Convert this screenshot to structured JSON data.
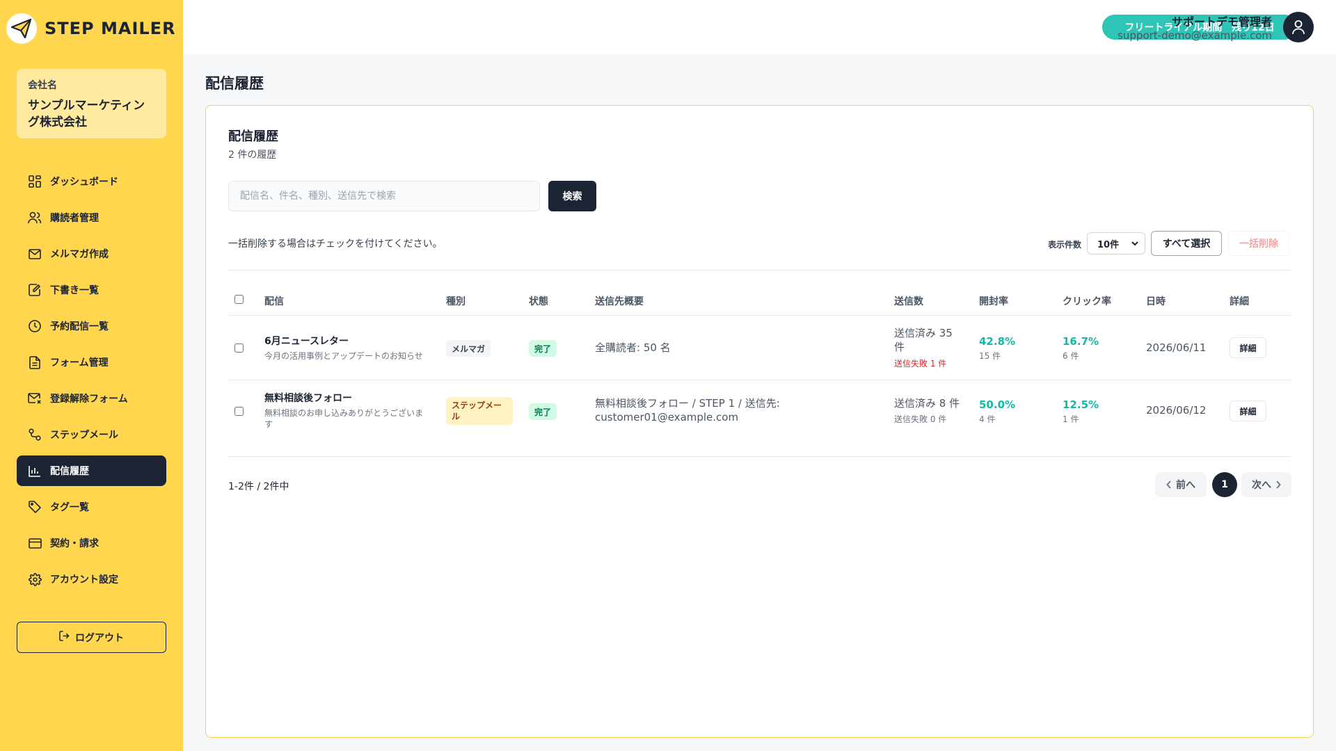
{
  "app": {
    "logo_text": "STEP MAILER"
  },
  "company": {
    "label": "会社名",
    "name": "サンプルマーケティング株式会社"
  },
  "sidebar": {
    "items": [
      {
        "label": "ダッシュボード",
        "icon": "dashboard-icon"
      },
      {
        "label": "購読者管理",
        "icon": "users-icon"
      },
      {
        "label": "メルマガ作成",
        "icon": "mail-icon"
      },
      {
        "label": "下書き一覧",
        "icon": "edit-icon"
      },
      {
        "label": "予約配信一覧",
        "icon": "clock-icon"
      },
      {
        "label": "フォーム管理",
        "icon": "document-icon"
      },
      {
        "label": "登録解除フォーム",
        "icon": "mail-x-icon"
      },
      {
        "label": "ステップメール",
        "icon": "route-icon"
      },
      {
        "label": "配信履歴",
        "icon": "bar-chart-icon",
        "active": true
      },
      {
        "label": "タグ一覧",
        "icon": "tag-icon"
      },
      {
        "label": "契約・請求",
        "icon": "credit-card-icon"
      },
      {
        "label": "アカウント設定",
        "icon": "gear-icon"
      }
    ],
    "logout_label": "ログアウト"
  },
  "header": {
    "trial": "フリートライアル期間　残り12日",
    "user_name": "サポートデモ管理者",
    "user_email": "support-demo@example.com"
  },
  "page": {
    "title": "配信履歴"
  },
  "card": {
    "title": "配信履歴",
    "subtitle": "2 件の履歴",
    "search_placeholder": "配信名、件名、種別、送信先で検索",
    "search_button": "検索",
    "note": "一括削除する場合はチェックを付けてください。",
    "per_page_label": "表示件数",
    "per_page_value": "10件",
    "select_all": "すべて選択",
    "bulk_delete": "一括削除"
  },
  "table": {
    "headers": {
      "delivery": "配信",
      "type": "種別",
      "status": "状態",
      "recipients": "送信先概要",
      "sent": "送信数",
      "open": "開封率",
      "click": "クリック率",
      "date": "日時",
      "detail": "詳細"
    },
    "rows": [
      {
        "title": "6月ニュースレター",
        "desc": "今月の活用事例とアップデートのお知らせ",
        "type": "メルマガ",
        "status": "完了",
        "recipients": "全購読者: 50 名",
        "sent": "送信済み 35 件",
        "failed": "送信失敗 1 件",
        "open_rate": "42.8%",
        "open_count": "15 件",
        "click_rate": "16.7%",
        "click_count": "6 件",
        "date": "2026/06/11",
        "detail": "詳細"
      },
      {
        "title": "無料相談後フォロー",
        "desc": "無料相談のお申し込みありがとうございます",
        "type": "ステップメール",
        "status": "完了",
        "recipients": "無料相談後フォロー / STEP 1 / 送信先: customer01@example.com",
        "sent": "送信済み 8 件",
        "failed": "送信失敗 0 件",
        "open_rate": "50.0%",
        "open_count": "4 件",
        "click_rate": "12.5%",
        "click_count": "1 件",
        "date": "2026/06/12",
        "detail": "詳細"
      }
    ]
  },
  "pagination": {
    "range": "1-2件 / 2件中",
    "prev": "前へ",
    "current": "1",
    "next": "次へ"
  },
  "colors": {
    "sidebar": "#ffd64d",
    "accent": "#2ec4b6",
    "navy": "#1c2433",
    "rate": "#14b8a6"
  }
}
